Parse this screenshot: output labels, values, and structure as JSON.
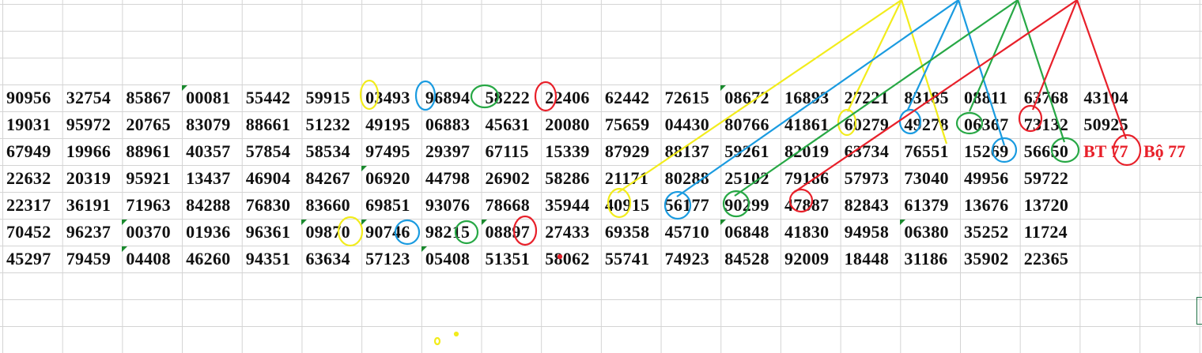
{
  "sheet": {
    "rows": [
      [
        "90956",
        "32754",
        "85867",
        "00081",
        "55442",
        "59915",
        "03493",
        "96894",
        "58222",
        "22406",
        "62442",
        "72615",
        "08672",
        "16893",
        "27221",
        "83185",
        "08811",
        "63768",
        "43104"
      ],
      [
        "19031",
        "95972",
        "20765",
        "83079",
        "88661",
        "51232",
        "49195",
        "06883",
        "45631",
        "20080",
        "75659",
        "04430",
        "80766",
        "41861",
        "60279",
        "49278",
        "06367",
        "73132",
        "50925"
      ],
      [
        "67949",
        "19966",
        "88961",
        "40357",
        "57854",
        "58534",
        "97495",
        "29397",
        "67115",
        "15339",
        "87929",
        "88137",
        "59261",
        "82019",
        "63734",
        "76551",
        "15269",
        "56650"
      ],
      [
        "22632",
        "20319",
        "95921",
        "13437",
        "46904",
        "84267",
        "06920",
        "44798",
        "26902",
        "58286",
        "21171",
        "80288",
        "25102",
        "79186",
        "57973",
        "73040",
        "49956",
        "59722"
      ],
      [
        "22317",
        "36191",
        "71963",
        "84288",
        "76830",
        "83660",
        "69851",
        "93076",
        "78668",
        "35944",
        "40915",
        "56177",
        "90299",
        "47887",
        "82843",
        "61379",
        "13676",
        "13720"
      ],
      [
        "70452",
        "96237",
        "00370",
        "01936",
        "96361",
        "09870",
        "90746",
        "98215",
        "08897",
        "27433",
        "69358",
        "45710",
        "06848",
        "41830",
        "94958",
        "06380",
        "35252",
        "11724"
      ],
      [
        "45297",
        "79459",
        "04408",
        "46260",
        "94351",
        "63634",
        "57123",
        "05408",
        "51351",
        "58062",
        "55741",
        "74923",
        "84528",
        "92009",
        "18448",
        "31186",
        "35902",
        "22365"
      ]
    ],
    "annotations": {
      "bt": "BT 77",
      "bo": "Bộ 77"
    }
  },
  "colors": {
    "yellow": "#f2ec1c",
    "blue": "#1a9be0",
    "green": "#27a845",
    "red": "#e8202a",
    "cell_flag": "#1a8a2e"
  }
}
